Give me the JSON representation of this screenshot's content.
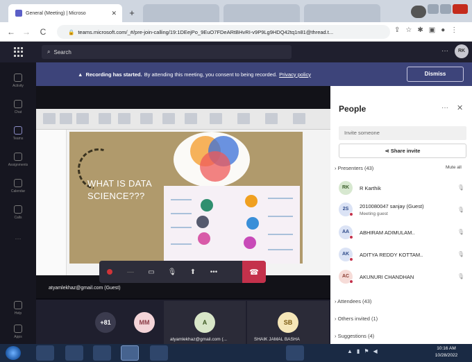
{
  "browser": {
    "tab_title": "General (Meeting) | Microso",
    "new_tab": "+",
    "url": "teams.microsoft.com/_#/pre-join-calling/19:1DEejPo_9EuO7FDeARtBHvRI-v9P9Lg9HDQ42tq1n81@thread.t...",
    "back": "←",
    "forward": "→",
    "reload": "C"
  },
  "teams": {
    "search_placeholder": "Search",
    "more": "···",
    "me_initials": "RK",
    "rail_labels": [
      "Activity",
      "Chat",
      "Teams",
      "Assignments",
      "Calendar",
      "Calls",
      "Help",
      "Apps"
    ]
  },
  "banner": {
    "prefix": "Recording has started.",
    "message": "By attending this meeting, you consent to being recorded.",
    "link": "Privacy policy",
    "dismiss": "Dismiss"
  },
  "slide": {
    "title_line1": "WHAT IS DATA",
    "title_line2": "SCIENCE???"
  },
  "stage": {
    "presenter": "atyamlekhaz@gmail.com (Guest)"
  },
  "gallery": {
    "overflow": "+81",
    "tiles": [
      {
        "initials": "MM",
        "label": "",
        "color": "#f3d4d8",
        "text": "#8a3b45"
      },
      {
        "initials": "A",
        "label": "atyamlekhaz@gmail.com (...",
        "color": "#d8e6c8",
        "text": "#3e5a22"
      },
      {
        "initials": "SB",
        "label": "SHAIK JAMAL BASHA",
        "color": "#f5e6b8",
        "text": "#7a5a10"
      }
    ]
  },
  "people": {
    "title": "People",
    "more": "···",
    "close": "✕",
    "invite_placeholder": "Invite someone",
    "share_invite": "Share invite",
    "presenters_label": "Presenters (43)",
    "mute_all": "Mute all",
    "presenters": [
      {
        "initials": "RK",
        "name": "R Karthik",
        "sub": "",
        "bg": "#d7e8d0",
        "fg": "#3b5e2b"
      },
      {
        "initials": "2S",
        "name": "2010080047 sanjay (Guest)",
        "sub": "Meeting guest",
        "bg": "#dbe3f5",
        "fg": "#2f4b8a"
      },
      {
        "initials": "AA",
        "name": "ABHIRAM ADIMULAM..",
        "sub": "",
        "bg": "#dbe3f5",
        "fg": "#2f4b8a"
      },
      {
        "initials": "AK",
        "name": "ADITYA REDDY KOTTAM..",
        "sub": "",
        "bg": "#dbe3f5",
        "fg": "#2f4b8a"
      },
      {
        "initials": "AC",
        "name": "AKUNURI CHANDHAN",
        "sub": "",
        "bg": "#f6dcd8",
        "fg": "#8a3b30"
      }
    ],
    "attendees_label": "Attendees (43)",
    "others_label": "Others invited (1)",
    "suggestions_label": "Suggestions (4)"
  },
  "taskbar": {
    "time": "10:16 AM",
    "date": "10/28/2022"
  },
  "colors": {
    "banner": "#3d447a",
    "hangup": "#c4314b",
    "teams_dark": "#1f1f2e"
  }
}
